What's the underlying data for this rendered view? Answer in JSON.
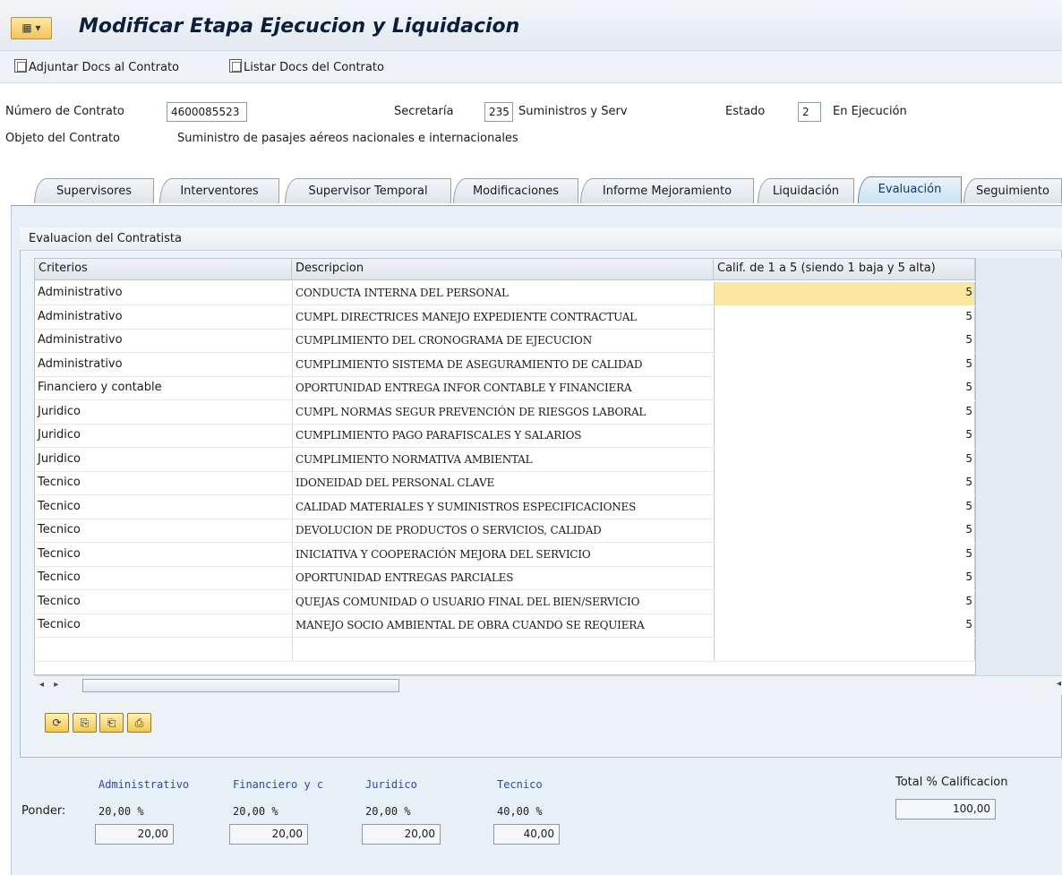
{
  "window": {
    "title": "Modificar Etapa Ejecucion y Liquidacion",
    "logo_icon": "sap-menu-icon"
  },
  "toolbar": {
    "attach_label": "Adjuntar Docs al Contrato",
    "list_label": "Listar Docs del Contrato"
  },
  "header": {
    "contract_number_label": "Número de Contrato",
    "contract_number_value": "4600085523",
    "secretary_label": "Secretaría",
    "secretary_code": "235",
    "secretary_name": "Suministros y Serv",
    "state_label": "Estado",
    "state_code": "2",
    "state_name": "En Ejecución",
    "object_label": "Objeto del Contrato",
    "object_value": "Suministro de pasajes aéreos nacionales e internacionales"
  },
  "tabs": [
    {
      "label": "Supervisores",
      "active": false
    },
    {
      "label": "Interventores",
      "active": false
    },
    {
      "label": "Supervisor Temporal",
      "active": false
    },
    {
      "label": "Modificaciones",
      "active": false
    },
    {
      "label": "Informe Mejoramiento",
      "active": false
    },
    {
      "label": "Liquidación",
      "active": false
    },
    {
      "label": "Evaluación",
      "active": true
    },
    {
      "label": "Seguimiento",
      "active": false
    }
  ],
  "evaluation": {
    "group_title": "Evaluacion del Contratista",
    "columns": [
      "Criterios",
      "Descripcion",
      "Calif. de 1 a 5 (siendo 1 baja y 5 alta)"
    ],
    "rows": [
      {
        "criterio": "Administrativo",
        "descripcion": "CONDUCTA INTERNA DEL PERSONAL",
        "calif": "5"
      },
      {
        "criterio": "Administrativo",
        "descripcion": "CUMPL DIRECTRICES MANEJO EXPEDIENTE CONTRACTUAL",
        "calif": "5"
      },
      {
        "criterio": "Administrativo",
        "descripcion": "CUMPLIMIENTO DEL CRONOGRAMA DE EJECUCION",
        "calif": "5"
      },
      {
        "criterio": "Administrativo",
        "descripcion": "CUMPLIMIENTO SISTEMA DE ASEGURAMIENTO DE CALIDAD",
        "calif": "5"
      },
      {
        "criterio": "Financiero y contable",
        "descripcion": "OPORTUNIDAD ENTREGA INFOR CONTABLE Y FINANCIERA",
        "calif": "5"
      },
      {
        "criterio": "Juridico",
        "descripcion": "CUMPL NORMAS SEGUR PREVENCIÓN DE RIESGOS LABORAL",
        "calif": "5"
      },
      {
        "criterio": "Juridico",
        "descripcion": "CUMPLIMIENTO PAGO PARAFISCALES Y SALARIOS",
        "calif": "5"
      },
      {
        "criterio": "Juridico",
        "descripcion": "CUMPLIMIENTO NORMATIVA AMBIENTAL",
        "calif": "5"
      },
      {
        "criterio": "Tecnico",
        "descripcion": "IDONEIDAD DEL PERSONAL CLAVE",
        "calif": "5"
      },
      {
        "criterio": "Tecnico",
        "descripcion": "CALIDAD MATERIALES Y SUMINISTROS ESPECIFICACIONES",
        "calif": "5"
      },
      {
        "criterio": "Tecnico",
        "descripcion": "DEVOLUCION DE PRODUCTOS O SERVICIOS, CALIDAD",
        "calif": "5"
      },
      {
        "criterio": "Tecnico",
        "descripcion": "INICIATIVA Y COOPERACIÓN MEJORA DEL SERVICIO",
        "calif": "5"
      },
      {
        "criterio": "Tecnico",
        "descripcion": "OPORTUNIDAD ENTREGAS PARCIALES",
        "calif": "5"
      },
      {
        "criterio": "Tecnico",
        "descripcion": "QUEJAS COMUNIDAD O USUARIO FINAL DEL BIEN/SERVICIO",
        "calif": "5"
      },
      {
        "criterio": "Tecnico",
        "descripcion": "MANEJO SOCIO AMBIENTAL DE OBRA CUANDO SE REQUIERA",
        "calif": "5"
      }
    ],
    "table_buttons": [
      {
        "icon": "table-action-1-icon",
        "glyph": "⟳"
      },
      {
        "icon": "table-action-2-icon",
        "glyph": "⎘"
      },
      {
        "icon": "table-action-3-icon",
        "glyph": "⎗"
      },
      {
        "icon": "table-action-4-icon",
        "glyph": "⎙"
      }
    ]
  },
  "weights": {
    "ponder_label": "Ponder:",
    "categories": [
      {
        "name": "Administrativo",
        "pct": "20,00 %",
        "value": "20,00"
      },
      {
        "name": "Financiero y c",
        "pct": "20,00 %",
        "value": "20,00"
      },
      {
        "name": "Juridico",
        "pct": "20,00 %",
        "value": "20,00"
      },
      {
        "name": "Tecnico",
        "pct": "40,00 %",
        "value": "40,00"
      }
    ],
    "total_label": "Total % Calificacion",
    "total_value": "100,00"
  }
}
